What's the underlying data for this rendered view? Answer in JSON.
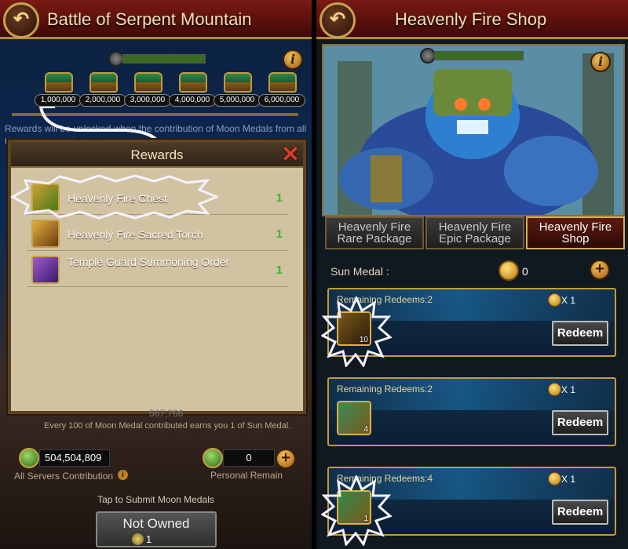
{
  "left": {
    "title": "Battle of Serpent Mountain",
    "chests": [
      "1,000,000",
      "2,000,000",
      "3,000,000",
      "4,000,000",
      "5,000,000",
      "6,000,000"
    ],
    "hint": "Rewards will be unlocked when the contribution of Moon Medals from all the servers reaches the amount.",
    "rewards": {
      "title": "Rewards",
      "items": [
        {
          "name": "Heavenly Fire Chest",
          "qty": "1"
        },
        {
          "name": "Heavenly Fire Sacred Torch",
          "qty": "1"
        },
        {
          "name": "Temple Guard Summoning Order",
          "qty": "1"
        }
      ]
    },
    "faded_number": "567,766",
    "medal_note": "Every 100 of Moon Medal contributed earns you 1 of Sun Medal.",
    "all_servers_value": "504,504,809",
    "all_servers_label": "All Servers Contribution",
    "personal_value": "0",
    "personal_label": "Personal Remain",
    "tap_text": "Tap to Submit Moon Medals",
    "button": {
      "label": "Not Owned",
      "cost": "1"
    }
  },
  "right": {
    "title": "Heavenly Fire Shop",
    "tabs": [
      {
        "label": "Heavenly Fire Rare Package",
        "active": false
      },
      {
        "label": "Heavenly Fire Epic Package",
        "active": false
      },
      {
        "label": "Heavenly Fire Shop",
        "active": true
      }
    ],
    "sun_label": "Sun Medal :",
    "sun_value": "0",
    "items": [
      {
        "redeems": "Remaining Redeems:2",
        "price": "X 1",
        "count": "10",
        "button": "Redeem"
      },
      {
        "redeems": "Remaining Redeems:2",
        "price": "X 1",
        "count": "4",
        "button": "Redeem"
      },
      {
        "redeems": "Remaining Redeems:4",
        "price": "X 1",
        "count": "1",
        "button": "Redeem"
      }
    ]
  },
  "icons": {
    "back": "back-arrow-icon",
    "info": "info-icon",
    "close": "close-icon",
    "plus": "plus-icon"
  },
  "colors": {
    "title_bar": "#5b100c",
    "gold_border": "#c59a3a",
    "qty_green": "#36b832"
  }
}
